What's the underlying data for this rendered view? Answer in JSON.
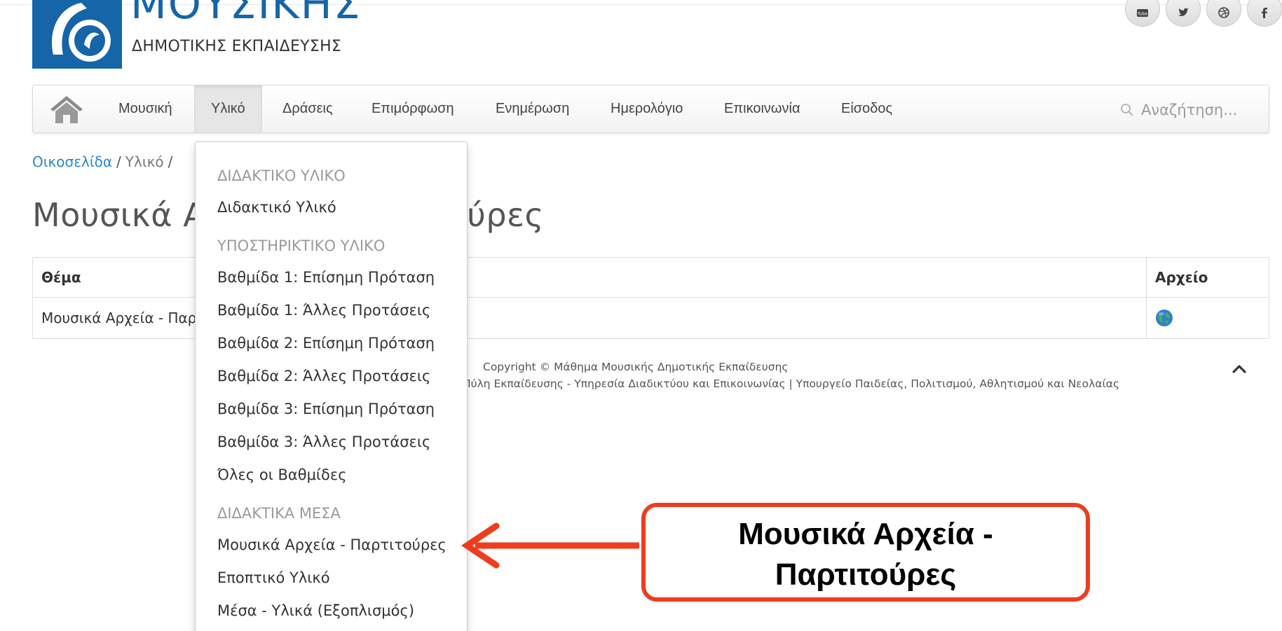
{
  "logo": {
    "title": "ΜΟΥΣΙΚΗΣ",
    "subtitle": "ΔΗΜΟΤΙΚΗΣ ΕΚΠΑΙΔΕΥΣΗΣ",
    "brand_color": "#1565a8"
  },
  "social": [
    {
      "icon": "youtube-icon"
    },
    {
      "icon": "twitter-icon"
    },
    {
      "icon": "dribbble-icon"
    },
    {
      "icon": "facebook-icon"
    }
  ],
  "nav": {
    "home_icon": "home-icon",
    "items": [
      {
        "label": "Μουσική",
        "active": false
      },
      {
        "label": "Υλικό",
        "active": true
      },
      {
        "label": "Δράσεις",
        "active": false
      },
      {
        "label": "Επιμόρφωση",
        "active": false
      },
      {
        "label": "Ενημέρωση",
        "active": false
      },
      {
        "label": "Ημερολόγιο",
        "active": false
      },
      {
        "label": "Επικοινωνία",
        "active": false
      },
      {
        "label": "Είσοδος",
        "active": false
      }
    ],
    "search_placeholder": "Αναζήτηση..."
  },
  "breadcrumb": {
    "home": "Οικοσελίδα",
    "separator": "/",
    "current": "Υλικό"
  },
  "page_title": "Μουσικά Αρχεία - Παρτιτούρες",
  "table": {
    "headers": [
      "Θέμα",
      "Αρχείο"
    ],
    "rows": [
      {
        "theme": "Μουσικά Αρχεία - Παρτιτούρες",
        "file_icon": "globe-icon"
      }
    ]
  },
  "footer": {
    "copyright": "Copyright ©  Μάθημα Μουσικής Δημοτικής Εκπαίδευσης",
    "credits": "Πύλη Εκπαίδευσης - Υπηρεσία Διαδικτύου και Επικοινωνίας | Υπουργείο Παιδείας, Πολιτισμού, Αθλητισμού και Νεολαίας"
  },
  "dropdown": {
    "sections": [
      {
        "header": "ΔΙΔΑΚΤΙΚΟ ΥΛΙΚΟ",
        "items": [
          "Διδακτικό Υλικό"
        ]
      },
      {
        "header": "ΥΠΟΣΤΗΡΙΚΤΙΚΟ ΥΛΙΚΟ",
        "items": [
          "Βαθμίδα 1: Επίσημη Πρόταση",
          "Βαθμίδα 1: Άλλες Προτάσεις",
          "Βαθμίδα 2: Επίσημη Πρόταση",
          "Βαθμίδα 2: Άλλες Προτάσεις",
          "Βαθμίδα 3: Επίσημη Πρόταση",
          "Βαθμίδα 3: Άλλες Προτάσεις",
          "Όλες οι Βαθμίδες"
        ]
      },
      {
        "header": "ΔΙΔΑΚΤΙΚΑ ΜΕΣΑ",
        "items": [
          "Μουσικά Αρχεία - Παρτιτούρες",
          "Εποπτικό Υλικό",
          "Μέσα - Υλικά (Εξοπλισμός)"
        ]
      }
    ]
  },
  "annotation": {
    "line1": "Μουσικά Αρχεία -",
    "line2": "Παρτιτούρες",
    "accent_color": "#f03c1e"
  }
}
